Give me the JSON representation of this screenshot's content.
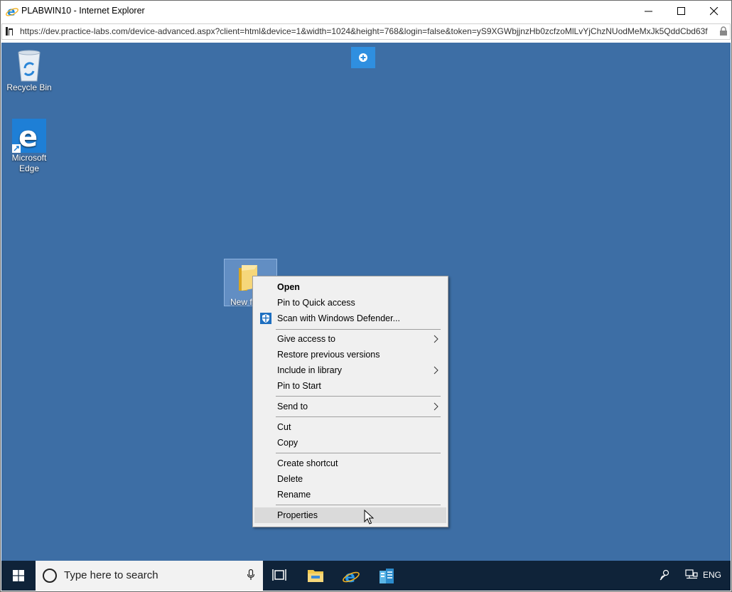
{
  "window": {
    "title": "PLABWIN10 - Internet Explorer",
    "url": "https://dev.practice-labs.com/device-advanced.aspx?client=html&device=1&width=1024&height=768&login=false&token=yS9XGWbjjnzHb0zcfzoMlLvYjChzNUodMeMxJk5QddCbd63f"
  },
  "desktop": {
    "background": "#3d6ea5",
    "icons": [
      {
        "label_line1": "Recycle Bin",
        "label_line2": ""
      },
      {
        "label_line1": "Microsoft",
        "label_line2": "Edge"
      }
    ],
    "selected_item_label": "New f"
  },
  "context_menu": {
    "items": [
      {
        "label": "Open",
        "bold": true
      },
      {
        "label": "Pin to Quick access"
      },
      {
        "label": "Scan with Windows Defender..."
      },
      {
        "label": "Give access to",
        "submenu": true
      },
      {
        "label": "Restore previous versions"
      },
      {
        "label": "Include in library",
        "submenu": true
      },
      {
        "label": "Pin to Start"
      },
      {
        "label": "Send to",
        "submenu": true
      },
      {
        "label": "Cut"
      },
      {
        "label": "Copy"
      },
      {
        "label": "Create shortcut"
      },
      {
        "label": "Delete"
      },
      {
        "label": "Rename"
      },
      {
        "label": "Properties",
        "highlighted": true
      }
    ]
  },
  "taskbar": {
    "search_placeholder": "Type here to search",
    "language": "ENG",
    "pinned": [
      "task-view-icon",
      "file-explorer-icon",
      "internet-explorer-icon",
      "server-manager-icon"
    ]
  },
  "colors": {
    "accent": "#2f8fe0",
    "taskbar": "#0f2339",
    "menu_bg": "#f0f0f0",
    "menu_highlight": "#dadada"
  }
}
